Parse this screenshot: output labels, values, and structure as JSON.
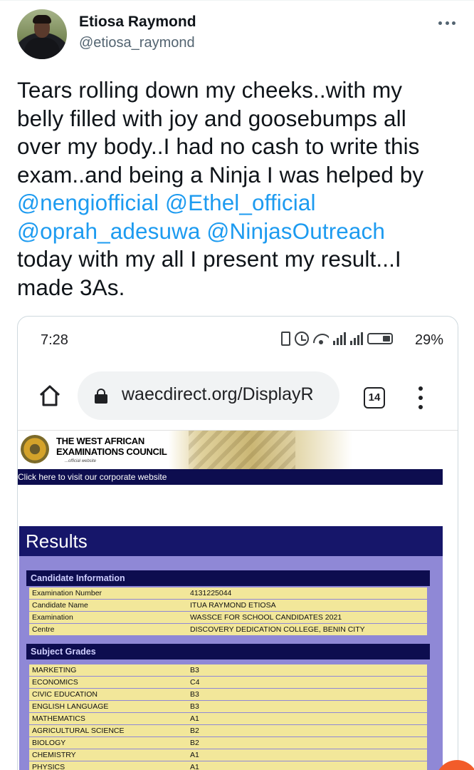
{
  "tweet": {
    "display_name": "Etiosa Raymond",
    "handle": "@etiosa_raymond",
    "text_lines": [
      [
        {
          "t": "Tears rolling down my cheeks..with my",
          "m": false
        }
      ],
      [
        {
          "t": "belly filled with joy and goosebumps all",
          "m": false
        }
      ],
      [
        {
          "t": "over my body..I had no cash to write this",
          "m": false
        }
      ],
      [
        {
          "t": "exam..and being a Ninja I was helped by",
          "m": false
        }
      ],
      [
        {
          "t": "@nengiofficial",
          "m": true
        },
        {
          "t": " ",
          "m": false
        },
        {
          "t": "@Ethel_official",
          "m": true
        }
      ],
      [
        {
          "t": "@oprah_adesuwa",
          "m": true
        },
        {
          "t": " ",
          "m": false
        },
        {
          "t": "@NinjasOutreach",
          "m": true
        }
      ],
      [
        {
          "t": "today with my all I present my result...I",
          "m": false
        }
      ],
      [
        {
          "t": "made 3As.",
          "m": false
        }
      ]
    ]
  },
  "phone": {
    "time": "7:28",
    "battery": "29%",
    "url": "waecdirect.org/DisplayR",
    "tab_count": "14"
  },
  "waec": {
    "title_line1": "THE WEST AFRICAN",
    "title_line2": "EXAMINATIONS COUNCIL",
    "tagline": "...official website",
    "corporate_link": "Click here to visit our corporate website",
    "results_title": "Results",
    "candidate_section": "Candidate Information",
    "candidate_rows": [
      {
        "label": "Examination Number",
        "value": "4131225044"
      },
      {
        "label": "Candidate Name",
        "value": "ITUA RAYMOND ETIOSA"
      },
      {
        "label": "Examination",
        "value": "WASSCE FOR SCHOOL CANDIDATES 2021"
      },
      {
        "label": "Centre",
        "value": "DISCOVERY DEDICATION COLLEGE, BENIN CITY"
      }
    ],
    "grades_section": "Subject Grades",
    "grade_rows": [
      {
        "label": "MARKETING",
        "value": "B3"
      },
      {
        "label": "ECONOMICS",
        "value": "C4"
      },
      {
        "label": "CIVIC EDUCATION",
        "value": "B3"
      },
      {
        "label": "ENGLISH LANGUAGE",
        "value": "B3"
      },
      {
        "label": "MATHEMATICS",
        "value": "A1"
      },
      {
        "label": "AGRICULTURAL SCIENCE",
        "value": "B2"
      },
      {
        "label": "BIOLOGY",
        "value": "B2"
      },
      {
        "label": "CHEMISTRY",
        "value": "A1"
      },
      {
        "label": "PHYSICS",
        "value": "A1"
      }
    ]
  },
  "colors": {
    "mention": "#1d9bf0",
    "waec_navy": "#0d0d4f",
    "results_purple": "#8f88d6",
    "row_yellow": "#f2e79a"
  }
}
